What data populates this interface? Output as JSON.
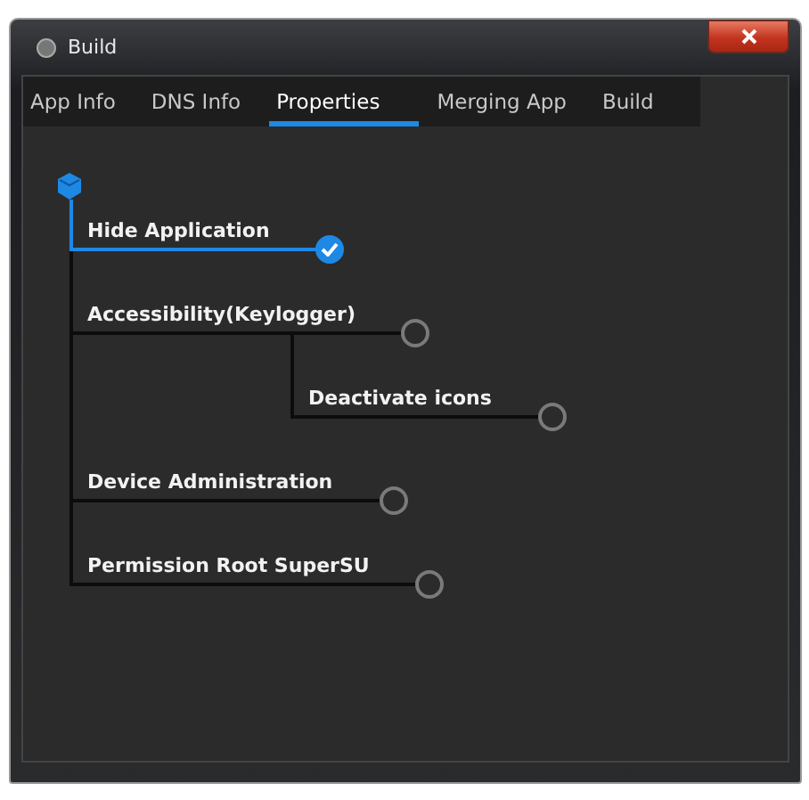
{
  "window": {
    "title": "Build"
  },
  "tabs": [
    {
      "label": "App Info",
      "selected": false
    },
    {
      "label": "DNS Info",
      "selected": false
    },
    {
      "label": "Properties",
      "selected": true
    },
    {
      "label": "Merging App",
      "selected": false
    },
    {
      "label": "Build",
      "selected": false
    }
  ],
  "options": [
    {
      "label": "Hide Application",
      "checked": true
    },
    {
      "label": "Accessibility(Keylogger)",
      "checked": false,
      "children": [
        {
          "label": "Deactivate icons",
          "checked": false
        }
      ]
    },
    {
      "label": "Device Administration",
      "checked": false
    },
    {
      "label": "Permission Root SuperSU",
      "checked": false
    }
  ]
}
